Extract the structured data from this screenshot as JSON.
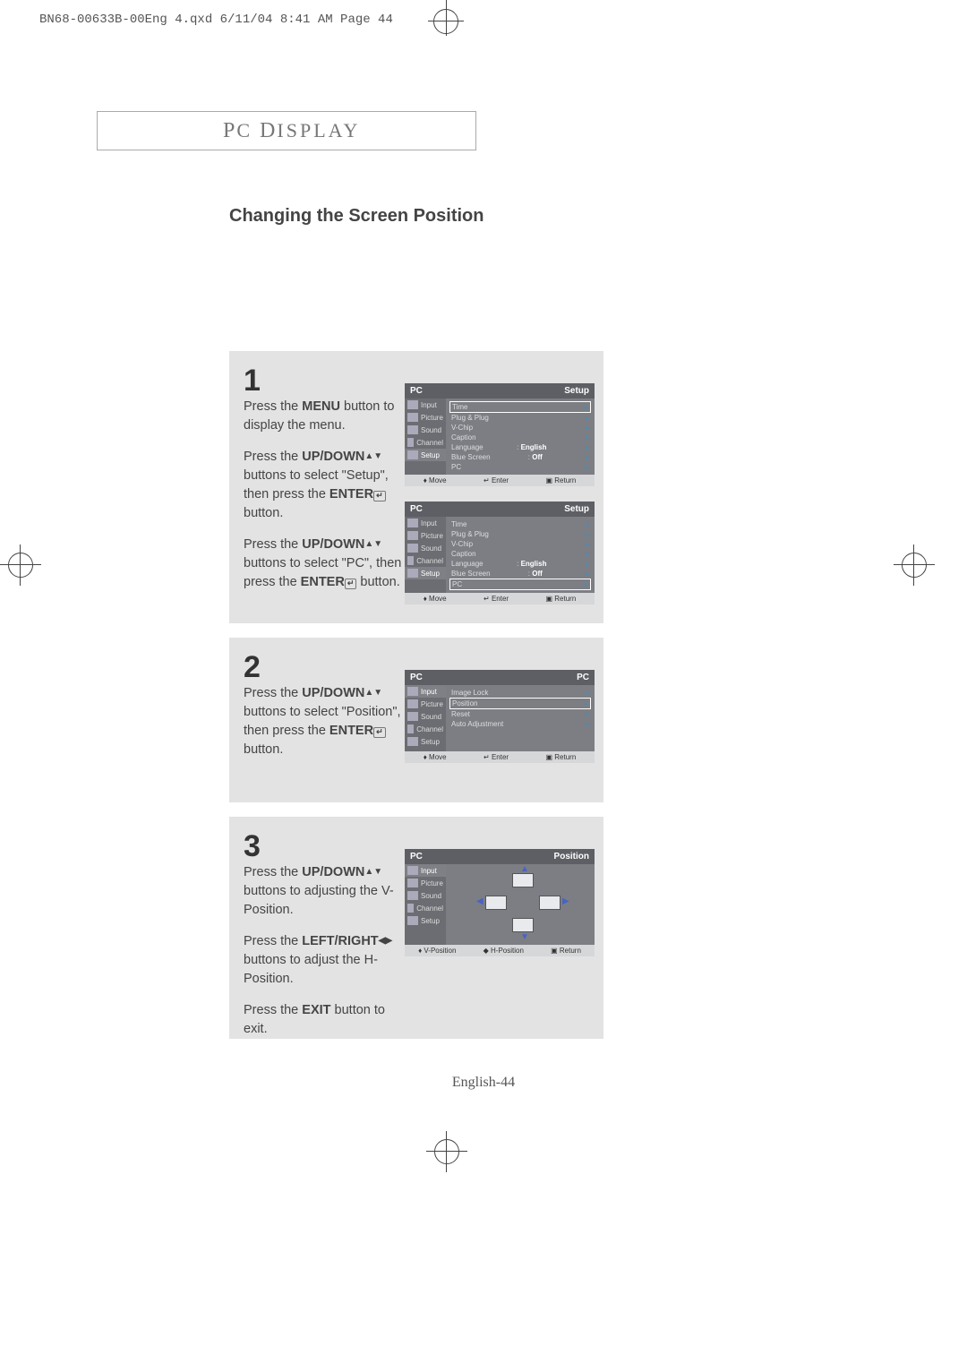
{
  "header_line": "BN68-00633B-00Eng 4.qxd  6/11/04 8:41 AM  Page 44",
  "doc_title_a": "P",
  "doc_title_b": "C",
  "doc_title_c": " D",
  "doc_title_d": "ISPLAY",
  "section_title": "Changing the Screen Position",
  "page_num": "English-44",
  "step1": {
    "num": "1",
    "p1_a": "Press the ",
    "p1_b": "MENU",
    "p1_c": " button to display the menu.",
    "p2_a": "Press the ",
    "p2_b": "UP/DOWN",
    "p2_c": " buttons to select \"Setup\", then press the ",
    "p2_d": "ENTER",
    "p2_e": " button.",
    "p3_a": "Press the ",
    "p3_b": "UP/DOWN",
    "p3_c": " buttons to select \"PC\", then press the ",
    "p3_d": "ENTER",
    "p3_e": " button."
  },
  "step2": {
    "num": "2",
    "p1_a": "Press the ",
    "p1_b": "UP/DOWN",
    "p1_c": " buttons to select \"Position\", then press the ",
    "p1_d": "ENTER",
    "p1_e": " button."
  },
  "step3": {
    "num": "3",
    "p1_a": "Press the ",
    "p1_b": "UP/DOWN",
    "p1_c": " buttons to adjusting the V-Position.",
    "p2_a": "Press the ",
    "p2_b": "LEFT/RIGHT",
    "p2_c": " buttons to adjust the H-Position.",
    "p3_a": "Press the ",
    "p3_b": "EXIT",
    "p3_c": " button to exit."
  },
  "osd_side": {
    "input": "Input",
    "picture": "Picture",
    "sound": "Sound",
    "channel": "Channel",
    "setup": "Setup"
  },
  "osd_foot": {
    "move": "Move",
    "enter": "Enter",
    "return": "Return",
    "vpos": "V-Position",
    "hpos": "H-Position"
  },
  "osd_setup_rows": {
    "time": "Time",
    "plug": "Plug & Plug",
    "vchip": "V-Chip",
    "caption": "Caption",
    "language": "Language",
    "language_val": "English",
    "bluescreen": "Blue Screen",
    "bluescreen_val": "Off",
    "pc": "PC"
  },
  "osd_pc_rows": {
    "imagelock": "Image Lock",
    "position": "Position",
    "reset": "Reset",
    "autoadj": "Auto Adjustment"
  },
  "osd_titles": {
    "pc": "PC",
    "setup": "Setup",
    "position": "Position"
  },
  "glyphs": {
    "updown": "▲▼",
    "leftright": "◀▶",
    "enter": "↵",
    "foot_updown": "♦",
    "foot_enter": "↵",
    "foot_return": "▣",
    "arrow_right": "▸",
    "pos_up": "▲",
    "pos_down": "▼",
    "pos_left": "◀",
    "pos_right": "▶"
  }
}
